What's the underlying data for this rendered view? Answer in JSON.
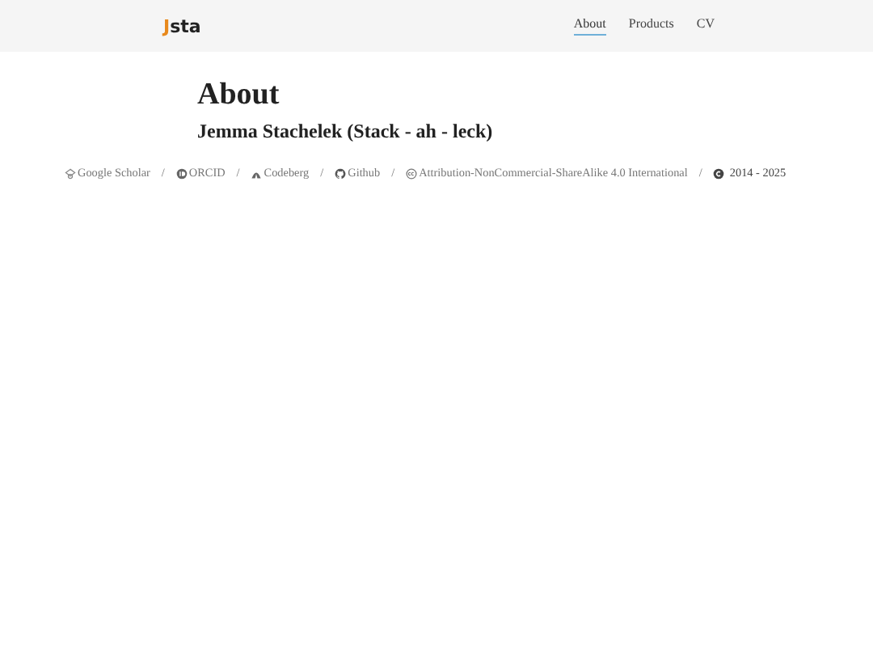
{
  "logo": {
    "accent": "J",
    "rest": "sta"
  },
  "nav": [
    {
      "label": "About",
      "selected": true
    },
    {
      "label": "Products",
      "selected": false
    },
    {
      "label": "CV",
      "selected": false
    }
  ],
  "heading": "About",
  "subtitle": "Jemma Stachelek (Stack - ah - leck)",
  "footer": [
    {
      "kind": "scholar",
      "label": "Google Scholar"
    },
    {
      "kind": "separator",
      "label": "/"
    },
    {
      "kind": "orcid",
      "label": "ORCID"
    },
    {
      "kind": "separator",
      "label": "/"
    },
    {
      "kind": "codeberg",
      "label": "Codeberg"
    },
    {
      "kind": "separator",
      "label": "/"
    },
    {
      "kind": "github",
      "label": "Github"
    },
    {
      "kind": "separator",
      "label": "/"
    },
    {
      "kind": "license",
      "label": "Attribution-NonCommercial-ShareAlike 4.0 International"
    },
    {
      "kind": "separator",
      "label": "/"
    },
    {
      "kind": "copyright",
      "label": "2014 - 2025"
    }
  ]
}
